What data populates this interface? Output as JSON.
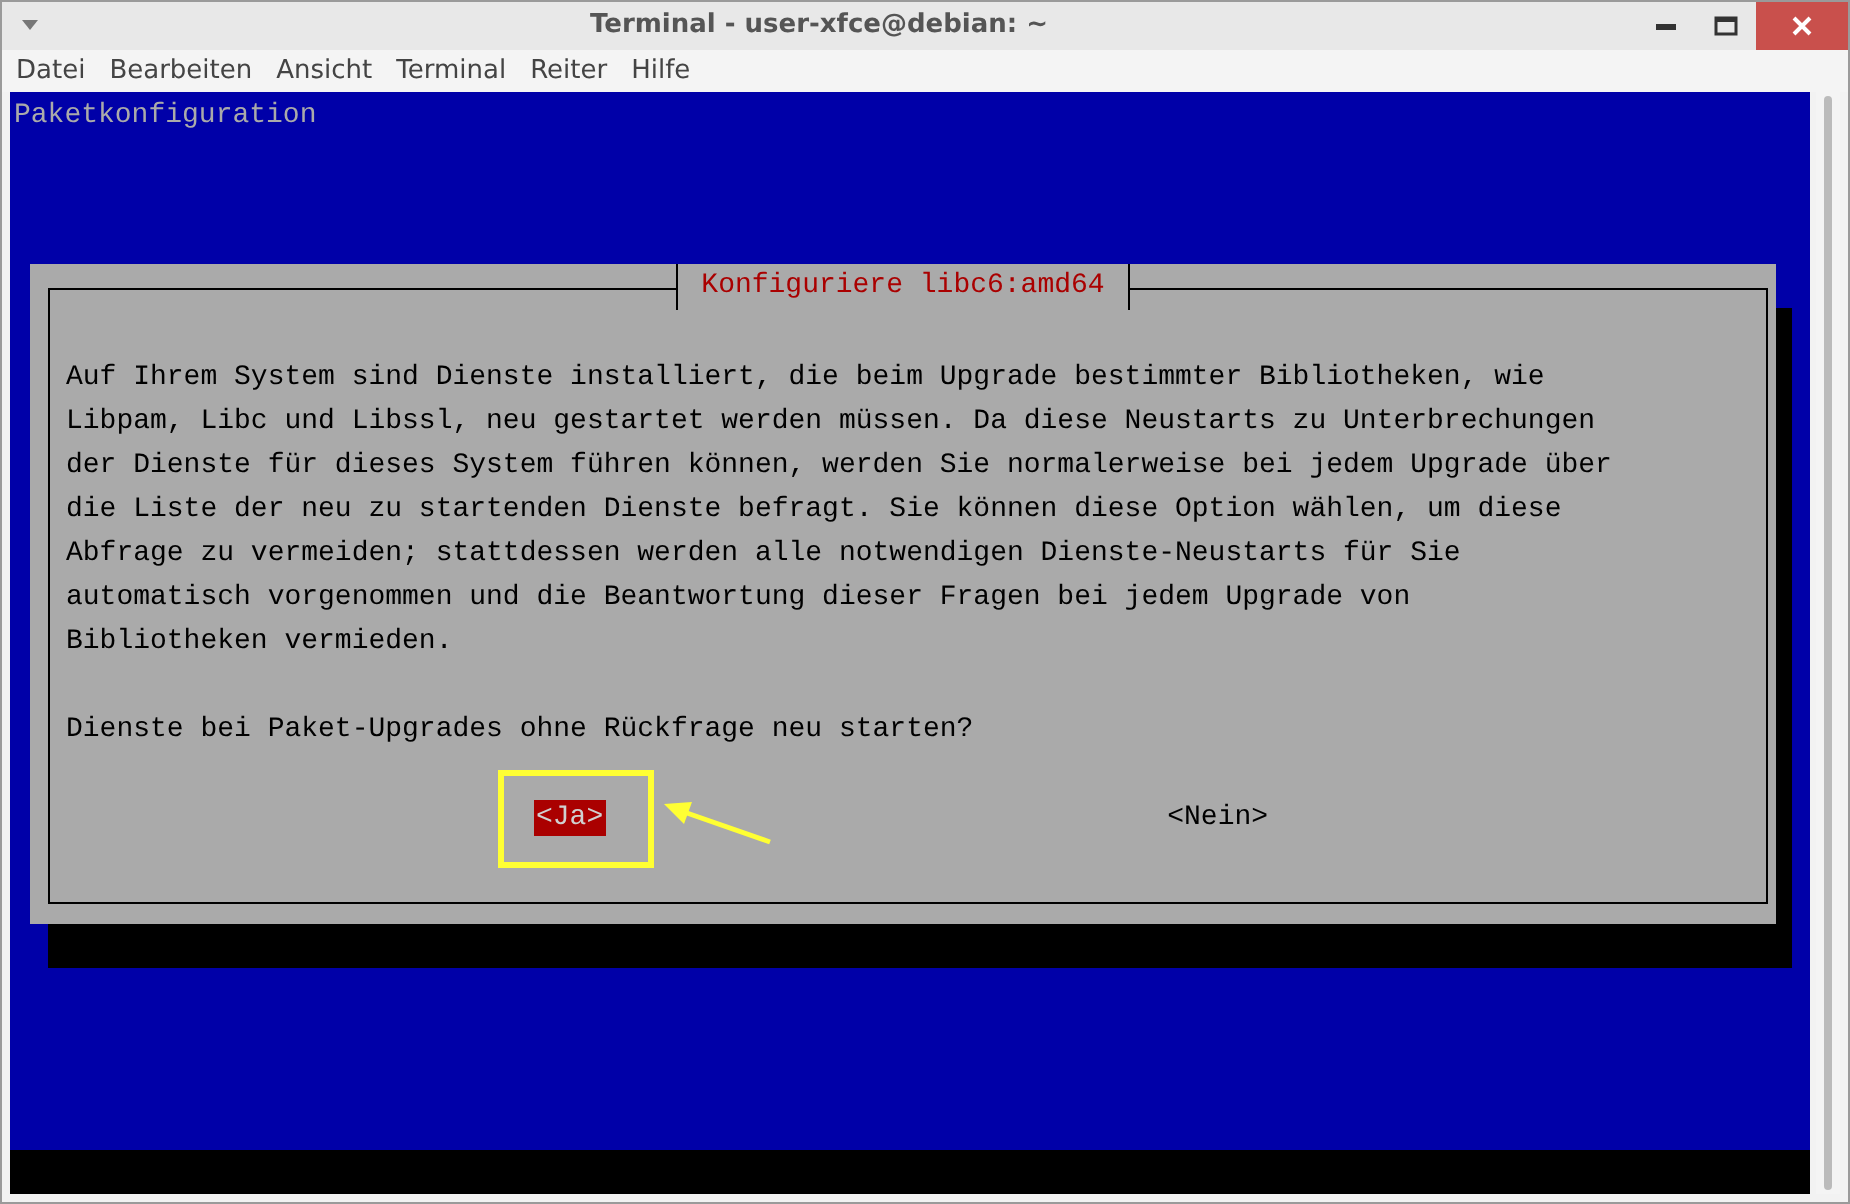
{
  "window": {
    "title": "Terminal - user-xfce@debian: ~"
  },
  "menu": [
    "Datei",
    "Bearbeiten",
    "Ansicht",
    "Terminal",
    "Reiter",
    "Hilfe"
  ],
  "terminal": {
    "header": "Paketkonfiguration",
    "dialog": {
      "title": "Konfiguriere libc6:amd64",
      "lines": [
        "Auf Ihrem System sind Dienste installiert, die beim Upgrade bestimmter Bibliotheken, wie",
        "Libpam, Libc und Libssl, neu gestartet werden müssen. Da diese Neustarts zu Unterbrechungen",
        "der Dienste für dieses System führen können, werden Sie normalerweise bei jedem Upgrade über",
        "die Liste der neu zu startenden Dienste befragt. Sie können diese Option wählen, um diese",
        "Abfrage zu vermeiden; stattdessen werden alle notwendigen Dienste-Neustarts für Sie",
        "automatisch vorgenommen und die Beantwortung dieser Fragen bei jedem Upgrade von",
        "Bibliotheken vermieden."
      ],
      "question": "Dienste bei Paket-Upgrades ohne Rückfrage neu starten?",
      "buttons": [
        {
          "label": "<Ja>",
          "selected": true
        },
        {
          "label": "<Nein>",
          "selected": false
        }
      ]
    }
  }
}
